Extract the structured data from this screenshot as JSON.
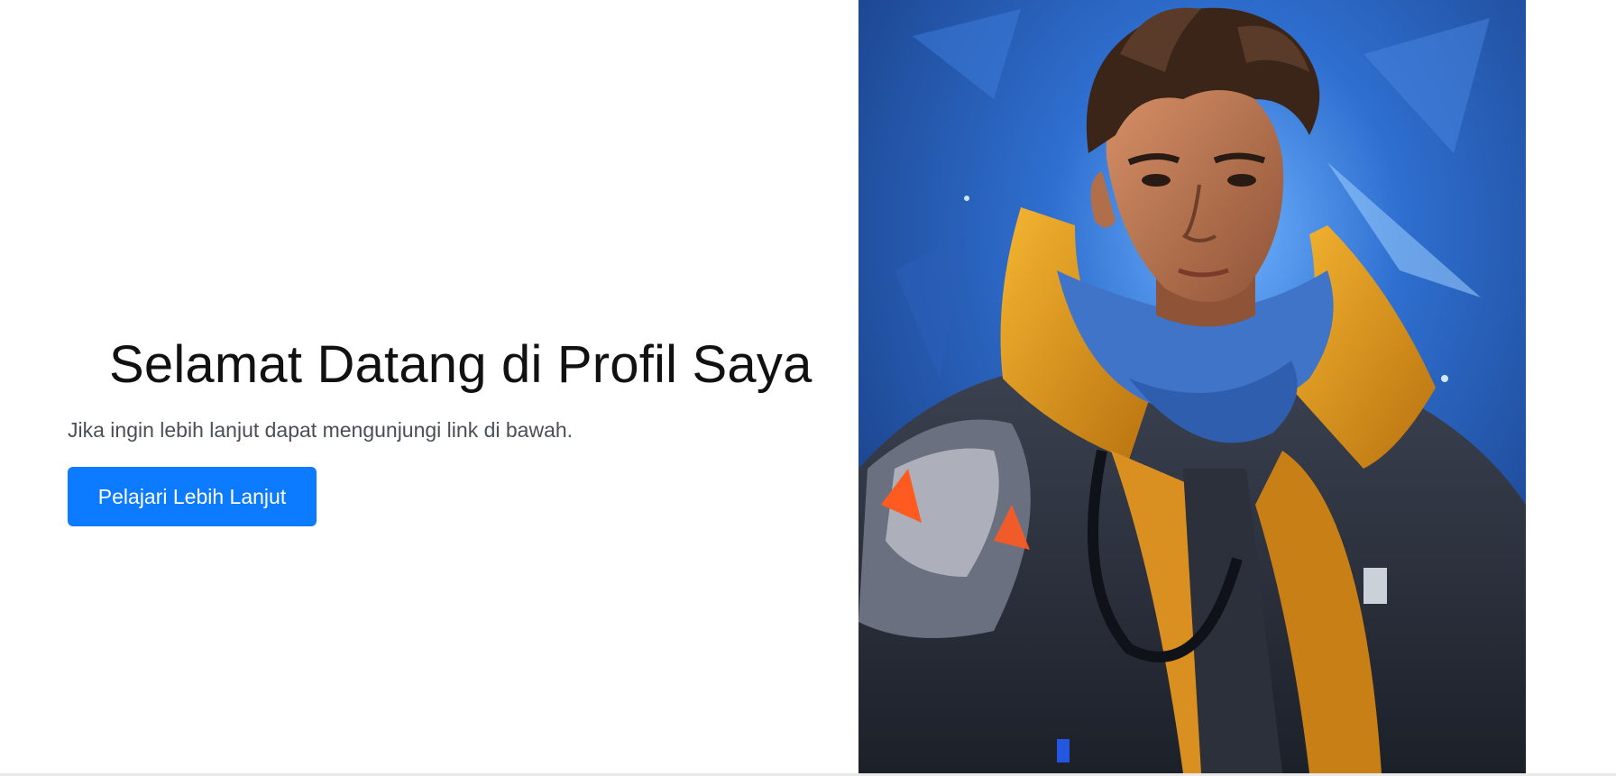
{
  "hero": {
    "title": "Selamat Datang di Profil Saya",
    "subtitle": "Jika ingin lebih lanjut dapat mengunjungi link di bawah.",
    "button_label": "Pelajari Lebih Lanjut"
  },
  "portrait": {
    "icon": "profile-portrait-illustration"
  },
  "colors": {
    "button": "#0d7bff",
    "title": "#111111",
    "subtitle": "#4a4f55",
    "portrait_background": "#1f4f9c",
    "jacket": "#e8a21f",
    "scarf": "#3f74c9"
  }
}
